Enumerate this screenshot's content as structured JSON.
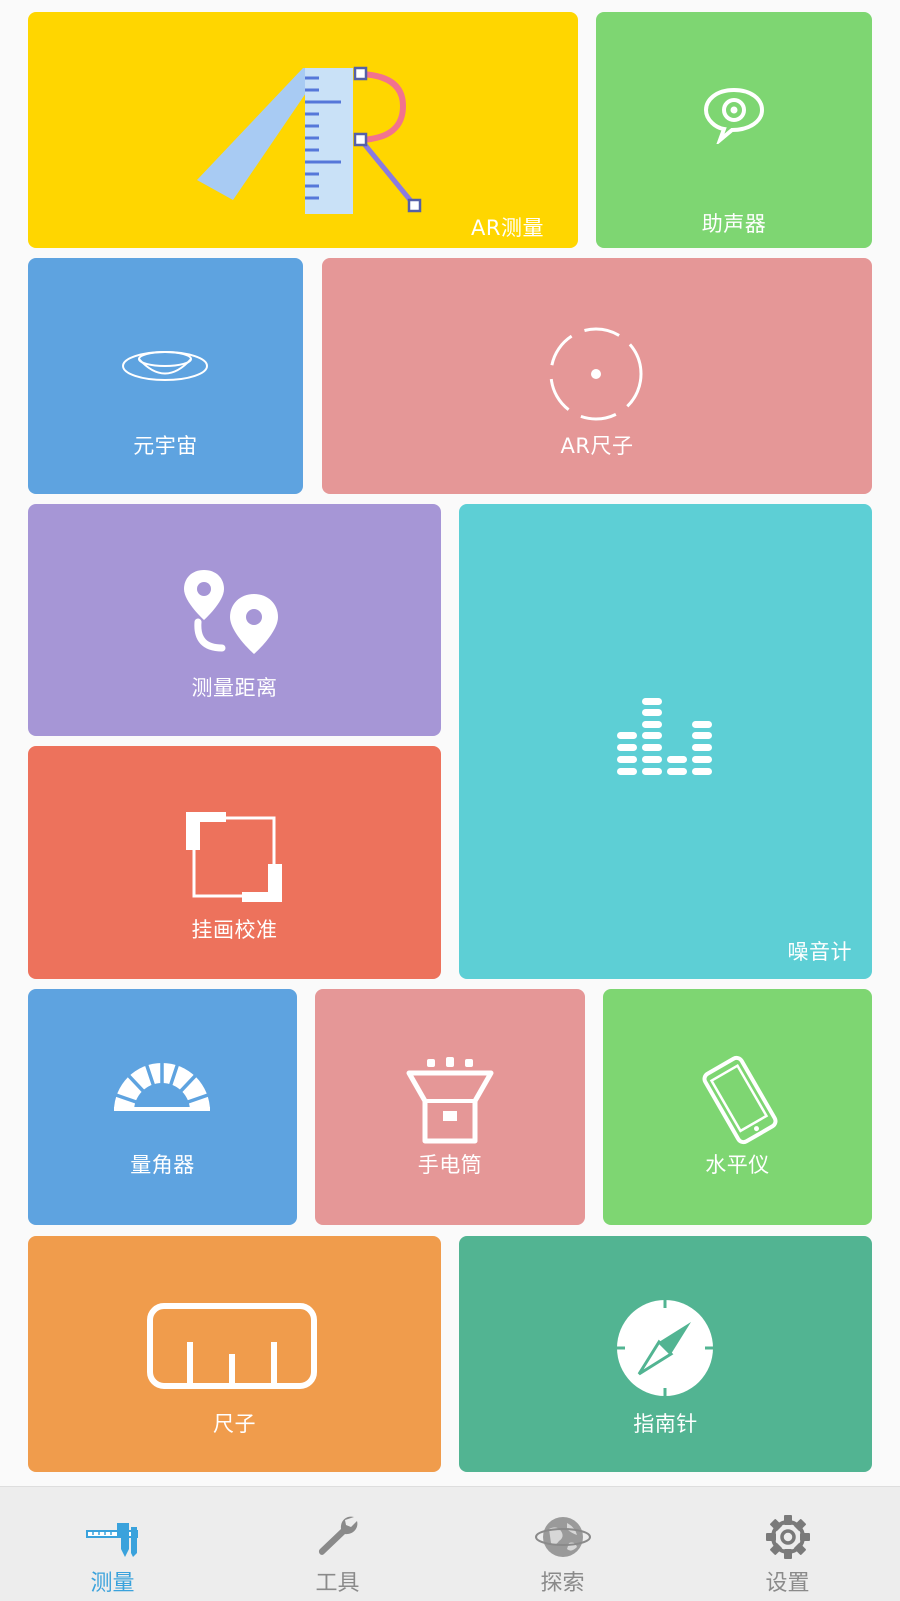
{
  "tiles": {
    "ar_measure": {
      "label": "AR测量",
      "icon": "ar-ruler-icon",
      "color": "#FFD600"
    },
    "hearing_aid": {
      "label": "助声器",
      "icon": "ear-icon",
      "color": "#7ED672"
    },
    "metaverse": {
      "label": "元宇宙",
      "icon": "planet-ring-icon",
      "color": "#5EA3E0"
    },
    "ar_ruler": {
      "label": "AR尺子",
      "icon": "target-circle-icon",
      "color": "#E59797"
    },
    "measure_distance": {
      "label": "测量距离",
      "icon": "map-pins-icon",
      "color": "#A696D6"
    },
    "noise_meter": {
      "label": "噪音计",
      "icon": "equalizer-bars-icon",
      "color": "#5DCFD5"
    },
    "picture_calibrate": {
      "label": "挂画校准",
      "icon": "frame-corners-icon",
      "color": "#ED725C"
    },
    "protractor": {
      "label": "量角器",
      "icon": "protractor-icon",
      "color": "#5EA3E0"
    },
    "flashlight": {
      "label": "手电筒",
      "icon": "flashlight-icon",
      "color": "#E59797"
    },
    "level": {
      "label": "水平仪",
      "icon": "tilted-phone-icon",
      "color": "#7ED672"
    },
    "ruler": {
      "label": "尺子",
      "icon": "ruler-icon",
      "color": "#F09C4C"
    },
    "compass": {
      "label": "指南针",
      "icon": "compass-icon",
      "color": "#52B492"
    }
  },
  "nav": {
    "active_color": "#3AA2DC",
    "inactive_color": "#8A8A8A",
    "items": [
      {
        "label": "测量",
        "icon": "caliper-icon",
        "active": true
      },
      {
        "label": "工具",
        "icon": "wrench-icon",
        "active": false
      },
      {
        "label": "探索",
        "icon": "globe-icon",
        "active": false
      },
      {
        "label": "设置",
        "icon": "gear-icon",
        "active": false
      }
    ]
  }
}
